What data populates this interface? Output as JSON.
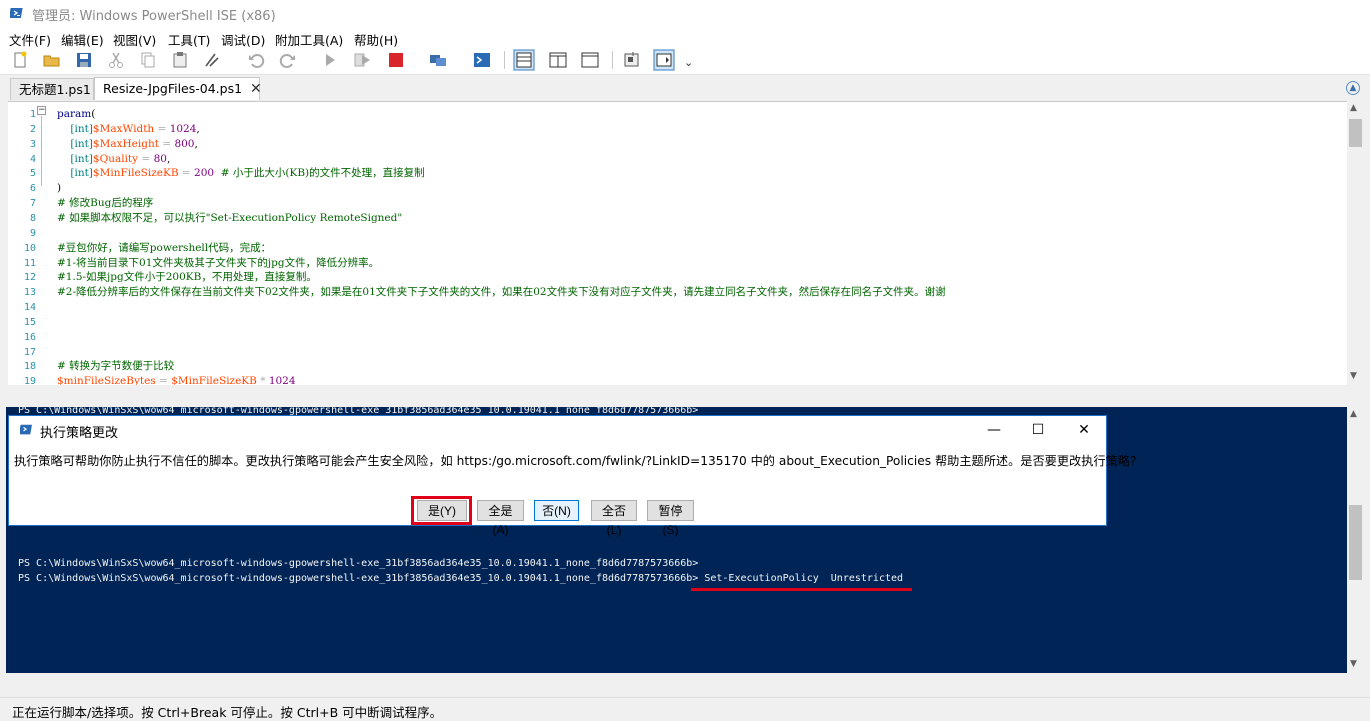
{
  "window": {
    "title": "管理员: Windows PowerShell ISE (x86)"
  },
  "menu": [
    "文件(F)",
    "编辑(E)",
    "视图(V)",
    "工具(T)",
    "调试(D)",
    "附加工具(A)",
    "帮助(H)"
  ],
  "toolbar": {
    "icons": [
      "new-file-icon",
      "open-icon",
      "save-icon",
      "cut-icon",
      "copy-icon",
      "paste-icon",
      "clear-icon",
      "undo-icon",
      "redo-icon",
      "run-icon",
      "run-selection-icon",
      "stop-icon",
      "remote-icon",
      "powershell-icon",
      "layout-top-icon",
      "layout-right-icon",
      "layout-max-icon",
      "show-commands-icon",
      "show-addon-icon"
    ],
    "overflow": "⌄"
  },
  "tabs": [
    {
      "label": "无标题1.ps1",
      "active": false
    },
    {
      "label": "Resize-JpgFiles-04.ps1",
      "active": true,
      "close": "✕"
    }
  ],
  "editor": {
    "lines": [
      {
        "n": "1",
        "text": "param("
      },
      {
        "n": "2",
        "text": "    [int]$MaxWidth = 1024,"
      },
      {
        "n": "3",
        "text": "    [int]$MaxHeight = 800,"
      },
      {
        "n": "4",
        "text": "    [int]$Quality = 80,"
      },
      {
        "n": "5",
        "text": "    [int]$MinFileSizeKB = 200  # 小于此大小(KB)的文件不处理，直接复制"
      },
      {
        "n": "6",
        "text": ")"
      },
      {
        "n": "7",
        "text": "# 修改Bug后的程序"
      },
      {
        "n": "8",
        "text": "# 如果脚本权限不足，可以执行\"Set-ExecutionPolicy RemoteSigned\""
      },
      {
        "n": "9",
        "text": ""
      },
      {
        "n": "10",
        "text": "#豆包你好，请编写powershell代码，完成："
      },
      {
        "n": "11",
        "text": "#1-将当前目录下01文件夹极其子文件夹下的jpg文件，降低分辨率。"
      },
      {
        "n": "12",
        "text": "#1.5-如果jpg文件小于200KB，不用处理，直接复制。"
      },
      {
        "n": "13",
        "text": "#2-降低分辨率后的文件保存在当前文件夹下02文件夹，如果是在01文件夹下子文件夹的文件，如果在02文件夹下没有对应子文件夹，请先建立同名子文件夹，然后保存在同名子文件夹。谢谢"
      },
      {
        "n": "14",
        "text": ""
      },
      {
        "n": "15",
        "text": ""
      },
      {
        "n": "16",
        "text": ""
      },
      {
        "n": "17",
        "text": ""
      },
      {
        "n": "18",
        "text": "# 转换为字节数便于比较"
      },
      {
        "n": "19",
        "text": "$minFileSizeBytes = $MinFileSizeKB * 1024"
      }
    ]
  },
  "console": {
    "partial_top_line": "PS C:\\Windows\\WinSxS\\wow64_microsoft-windows-gpowershell-exe_31bf3856ad364e35_10.0.19041.1_none_f8d6d7787573666b>",
    "prompt1": "PS C:\\Windows\\WinSxS\\wow64_microsoft-windows-gpowershell-exe_31bf3856ad364e35_10.0.19041.1_none_f8d6d7787573666b>",
    "prompt2": "PS C:\\Windows\\WinSxS\\wow64_microsoft-windows-gpowershell-exe_31bf3856ad364e35_10.0.19041.1_none_f8d6d7787573666b>",
    "command": " Set-ExecutionPolicy  Unrestricted"
  },
  "dialog": {
    "title": "执行策略更改",
    "message": "执行策略可帮助你防止执行不信任的脚本。更改执行策略可能会产生安全风险，如 https:/go.microsoft.com/fwlink/?LinkID=135170 中的 about_Execution_Policies 帮助主题所述。是否要更改执行策略?",
    "buttons": {
      "yes": "是(Y)",
      "yes_all": "全是(A)",
      "no": "否(N)",
      "no_all": "全否(L)",
      "suspend": "暂停(S)"
    },
    "controls": {
      "minimize": "—",
      "maximize": "☐",
      "close": "✕"
    }
  },
  "status": {
    "text": "正在运行脚本/选择项。按 Ctrl+Break 可停止。按 Ctrl+B 可中断调试程序。"
  },
  "colors": {
    "console_bg": "#012456",
    "highlight": "#e0001a",
    "accent": "#0078d7"
  }
}
